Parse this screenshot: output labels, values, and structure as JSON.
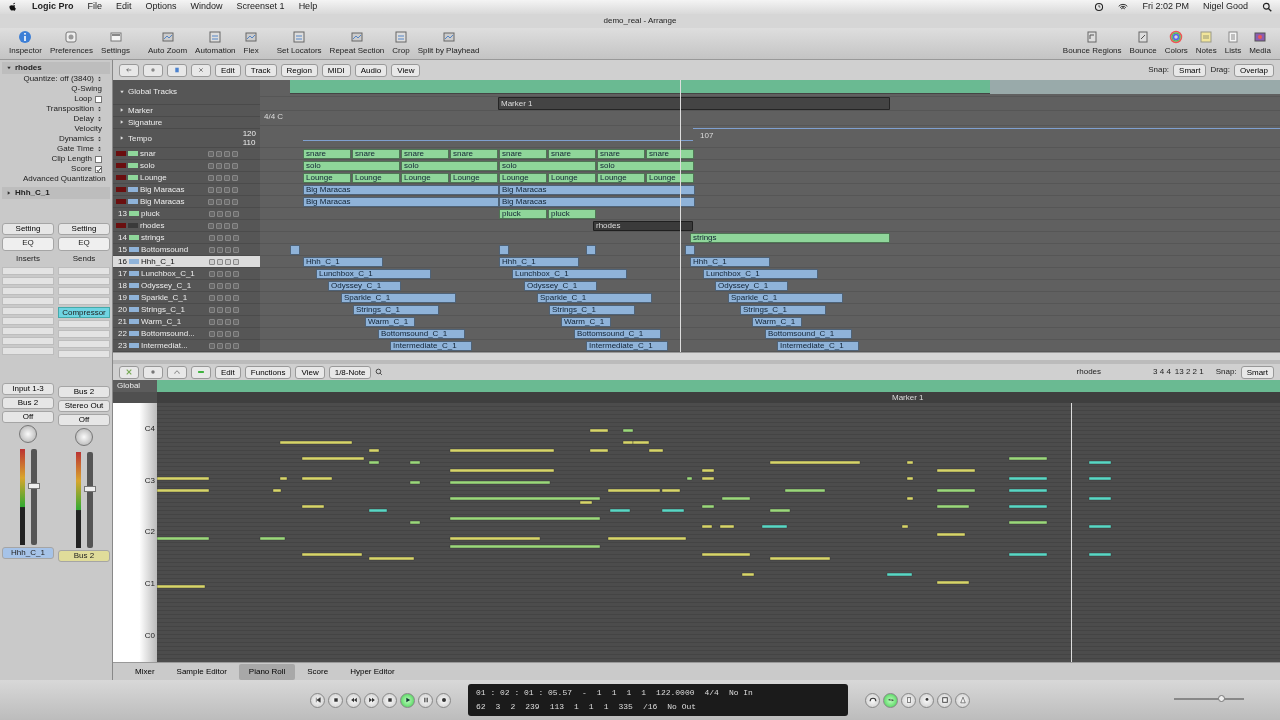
{
  "menu_bar": {
    "app": "Logic Pro",
    "items": [
      "File",
      "Edit",
      "Options",
      "Window",
      "Screenset 1",
      "Help"
    ],
    "clock": "Fri 2:02 PM",
    "user": "Nigel Good"
  },
  "window": {
    "title": "demo_real - Arrange"
  },
  "toolbar": {
    "left": [
      "Inspector",
      "Preferences",
      "Settings",
      "Auto Zoom",
      "Automation",
      "Flex",
      "Set Locators",
      "Repeat Section",
      "Crop",
      "Split by Playhead"
    ],
    "right": [
      "Bounce Regions",
      "Bounce",
      "Colors",
      "Notes",
      "Lists",
      "Media"
    ]
  },
  "inspector": {
    "region": "rhodes",
    "params": [
      {
        "label": "Quantize: off (3840)",
        "kind": "menu"
      },
      {
        "label": "Q-Swing",
        "kind": "plain"
      },
      {
        "label": "Loop",
        "kind": "check",
        "checked": false
      },
      {
        "label": "Transposition",
        "kind": "menu"
      },
      {
        "label": "Delay",
        "kind": "menu"
      },
      {
        "label": "Velocity",
        "kind": "plain"
      },
      {
        "label": "Dynamics",
        "kind": "menu"
      },
      {
        "label": "Gate Time",
        "kind": "menu"
      },
      {
        "label": "Clip Length",
        "kind": "check",
        "checked": false
      },
      {
        "label": "Score",
        "kind": "check",
        "checked": true
      }
    ],
    "advanced": "Advanced Quantization",
    "track": "Hhh_C_1"
  },
  "channel_strips": [
    {
      "setting": "Setting",
      "eq": "EQ",
      "slot_label": "Inserts",
      "input": "Input 1-3",
      "output": "Bus 2",
      "automation": "Off",
      "name": "Hhh_C_1",
      "level": 0.62
    },
    {
      "setting": "Setting",
      "eq": "EQ",
      "slot_label": "Sends",
      "insert": "Compressor",
      "input": "Bus 2",
      "output": "Stereo Out",
      "automation": "Off",
      "name": "Bus 2",
      "level": 0.62
    }
  ],
  "arrange": {
    "menus": [
      "Edit",
      "Track",
      "Region",
      "MIDI",
      "Audio",
      "View"
    ],
    "snap_label": "Snap:",
    "snap": "Smart",
    "drag_label": "Drag:",
    "drag": "Overlap",
    "global_tracks": {
      "title": "Global Tracks",
      "rows": [
        "Marker",
        "Signature",
        "Tempo"
      ],
      "marker": "Marker 1",
      "signature": "4/4 C",
      "tempo_high": "120",
      "tempo_low": "110",
      "tempo_value": "107"
    },
    "tracks": [
      {
        "kind": "labeled",
        "name": "snar",
        "color": "#8fd69a",
        "selected": false,
        "regions": [
          "snare",
          "snare",
          "snare",
          "snare",
          "snare",
          "snare",
          "snare",
          "snare"
        ]
      },
      {
        "kind": "labeled",
        "name": "solo",
        "color": "#8fd69a",
        "selected": false,
        "regions": [
          "solo",
          "solo",
          "solo",
          "solo"
        ]
      },
      {
        "kind": "labeled",
        "name": "Lounge",
        "color": "#8fd69a",
        "selected": false,
        "regions": [
          "Lounge",
          "Lounge",
          "Lounge",
          "Lounge",
          "Lounge",
          "Lounge",
          "Lounge",
          "Lounge"
        ]
      },
      {
        "kind": "labeled",
        "name": "Big Maracas",
        "color": "#8fb3d9",
        "selected": false,
        "regions": [
          "Big Maracas",
          "Big Maracas"
        ]
      },
      {
        "kind": "labeled",
        "name": "Big Maracas",
        "color": "#8fb3d9",
        "selected": false,
        "regions": [
          "Big Maracas",
          "Big Maracas"
        ]
      },
      {
        "number": "13",
        "name": "pluck",
        "color": "#8fd69a",
        "selected": false,
        "regions": [
          "pluck",
          "pluck"
        ]
      },
      {
        "kind": "labeled",
        "name": "rhodes",
        "color": "#3a3a3a",
        "selected": false,
        "regions": [
          "rhodes"
        ]
      },
      {
        "number": "14",
        "name": "strings",
        "color": "#8fd69a",
        "selected": false,
        "regions": [
          "strings"
        ]
      },
      {
        "number": "15",
        "name": "Bottomsound",
        "color": "#8fb3d9",
        "selected": false,
        "kind": "stubs"
      },
      {
        "number": "16",
        "name": "Hhh_C_1",
        "color": "#8fb3d9",
        "selected": true,
        "regions": [
          "Hhh_C_1",
          "Hhh_C_1",
          "Hhh_C_1"
        ]
      },
      {
        "number": "17",
        "name": "Lunchbox_C_1",
        "color": "#8fb3d9",
        "selected": false,
        "regions": [
          "Lunchbox_C_1",
          "Lunchbox_C_1",
          "Lunchbox_C_1"
        ]
      },
      {
        "number": "18",
        "name": "Odyssey_C_1",
        "color": "#8fb3d9",
        "selected": false,
        "regions": [
          "Odyssey_C_1",
          "Odyssey_C_1",
          "Odyssey_C_1"
        ]
      },
      {
        "number": "19",
        "name": "Sparkle_C_1",
        "color": "#8fb3d9",
        "selected": false,
        "regions": [
          "Sparkle_C_1",
          "Sparkle_C_1",
          "Sparkle_C_1"
        ]
      },
      {
        "number": "20",
        "name": "Strings_C_1",
        "color": "#8fb3d9",
        "selected": false,
        "regions": [
          "Strings_C_1",
          "Strings_C_1",
          "Strings_C_1"
        ]
      },
      {
        "number": "21",
        "name": "Warm_C_1",
        "color": "#8fb3d9",
        "selected": false,
        "regions": [
          "Warm_C_1",
          "Warm_C_1",
          "Warm_C_1"
        ]
      },
      {
        "number": "22",
        "name": "Bottomsound...",
        "color": "#8fb3d9",
        "selected": false,
        "regions": [
          "Bottomsound_C_1",
          "Bottomsound_C_1",
          "Bottomsound_C_1"
        ]
      },
      {
        "number": "23",
        "name": "Intermediat...",
        "color": "#8fb3d9",
        "selected": false,
        "regions": [
          "Intermediate_C_1",
          "Intermediate_C_1",
          "Intermediate_C_1"
        ]
      }
    ]
  },
  "piano_roll": {
    "menus": [
      "Edit",
      "Functions",
      "View"
    ],
    "quantize": "1/8-Note",
    "region": "rhodes",
    "position": "3 4 4",
    "position_2": "13 2 2 1",
    "snap_label": "Snap:",
    "snap": "Smart",
    "global": "Global",
    "marker": "Marker 1",
    "keys": [
      "C4",
      "C3",
      "C2",
      "C1",
      "C0"
    ]
  },
  "editor_tabs": [
    {
      "label": "Mixer",
      "selected": false
    },
    {
      "label": "Sample Editor",
      "selected": false
    },
    {
      "label": "Piano Roll",
      "selected": true
    },
    {
      "label": "Score",
      "selected": false
    },
    {
      "label": "Hyper Editor",
      "selected": false
    }
  ],
  "transport": {
    "lcd": [
      [
        "01 : 02 : 01 : 05.57",
        "-",
        "1",
        "1",
        "1",
        "1",
        "122.0000",
        "4/4",
        "No In"
      ],
      [
        "62",
        "3",
        "2",
        "239",
        "113",
        "1",
        "1",
        "1",
        "335",
        "/16",
        "No Out"
      ]
    ],
    "play": true,
    "cycle": true,
    "volume": {
      "level": 0.7
    }
  }
}
